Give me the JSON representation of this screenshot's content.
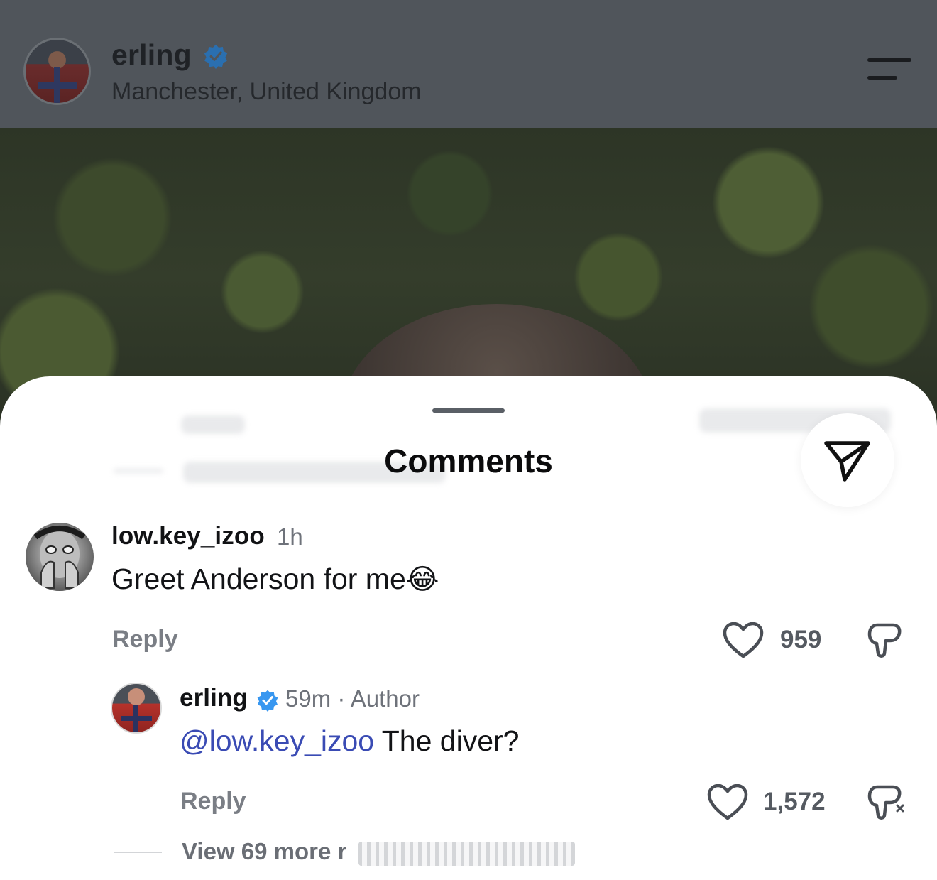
{
  "post": {
    "username": "erling",
    "location": "Manchester, United Kingdom",
    "verified": true
  },
  "comments_sheet": {
    "title": "Comments"
  },
  "comments": [
    {
      "username": "low.key_izoo",
      "time": "1h",
      "text": "Greet Anderson for me",
      "emoji": "😂",
      "reply_label": "Reply",
      "likes": "959"
    }
  ],
  "reply": {
    "username": "erling",
    "verified": true,
    "time": "59m",
    "separator": "·",
    "author_label": "Author",
    "mention": "@low.key_izoo",
    "text": " The diver?",
    "reply_label": "Reply",
    "likes": "1,572"
  },
  "view_more_label": "View 69 more r",
  "colors": {
    "verified_blue": "#3897f0",
    "mention": "#3a4bb4",
    "header_dim": "#50555b"
  }
}
